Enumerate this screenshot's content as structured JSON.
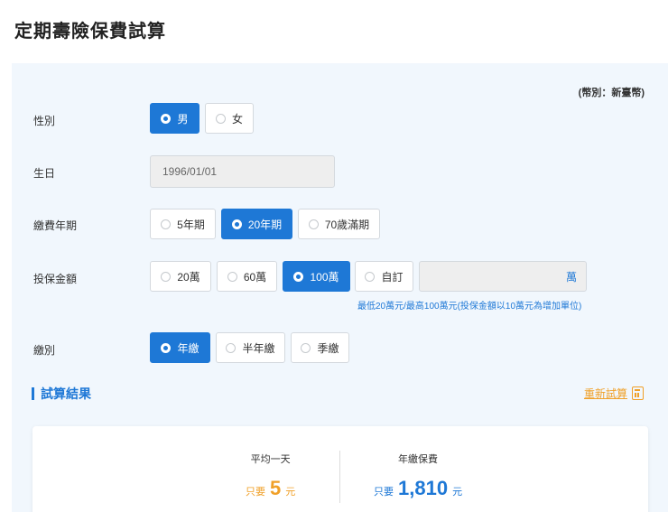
{
  "page": {
    "title": "定期壽險保費試算"
  },
  "form": {
    "currency_note": "(幣別：新臺幣)",
    "gender": {
      "label": "性別",
      "options": [
        "男",
        "女"
      ],
      "selected": "男"
    },
    "birthday": {
      "label": "生日",
      "value": "1996/01/01"
    },
    "payment_term": {
      "label": "繳費年期",
      "options": [
        "5年期",
        "20年期",
        "70歲滿期"
      ],
      "selected": "20年期"
    },
    "insured_amount": {
      "label": "投保金額",
      "options": [
        "20萬",
        "60萬",
        "100萬",
        "自訂"
      ],
      "selected": "100萬",
      "custom_unit": "萬",
      "hint": "最低20萬元/最高100萬元(投保金額以10萬元為增加單位)"
    },
    "payment_mode": {
      "label": "繳別",
      "options": [
        "年繳",
        "半年繳",
        "季繳"
      ],
      "selected": "年繳"
    }
  },
  "result": {
    "title": "試算結果",
    "recalc_label": "重新試算",
    "daily": {
      "label": "平均一天",
      "prefix": "只要",
      "value": "5",
      "unit": "元",
      "color": "#f0a028"
    },
    "annual": {
      "label": "年繳保費",
      "prefix": "只要",
      "value": "1,810",
      "unit": "元",
      "color": "#1e78d6"
    }
  },
  "colors": {
    "accent": "#1e78d6",
    "highlight": "#f0a028",
    "panel_bg": "#f1f7fd"
  },
  "icons": {
    "recalc": "calculator-icon",
    "radio": "radio-icon"
  }
}
